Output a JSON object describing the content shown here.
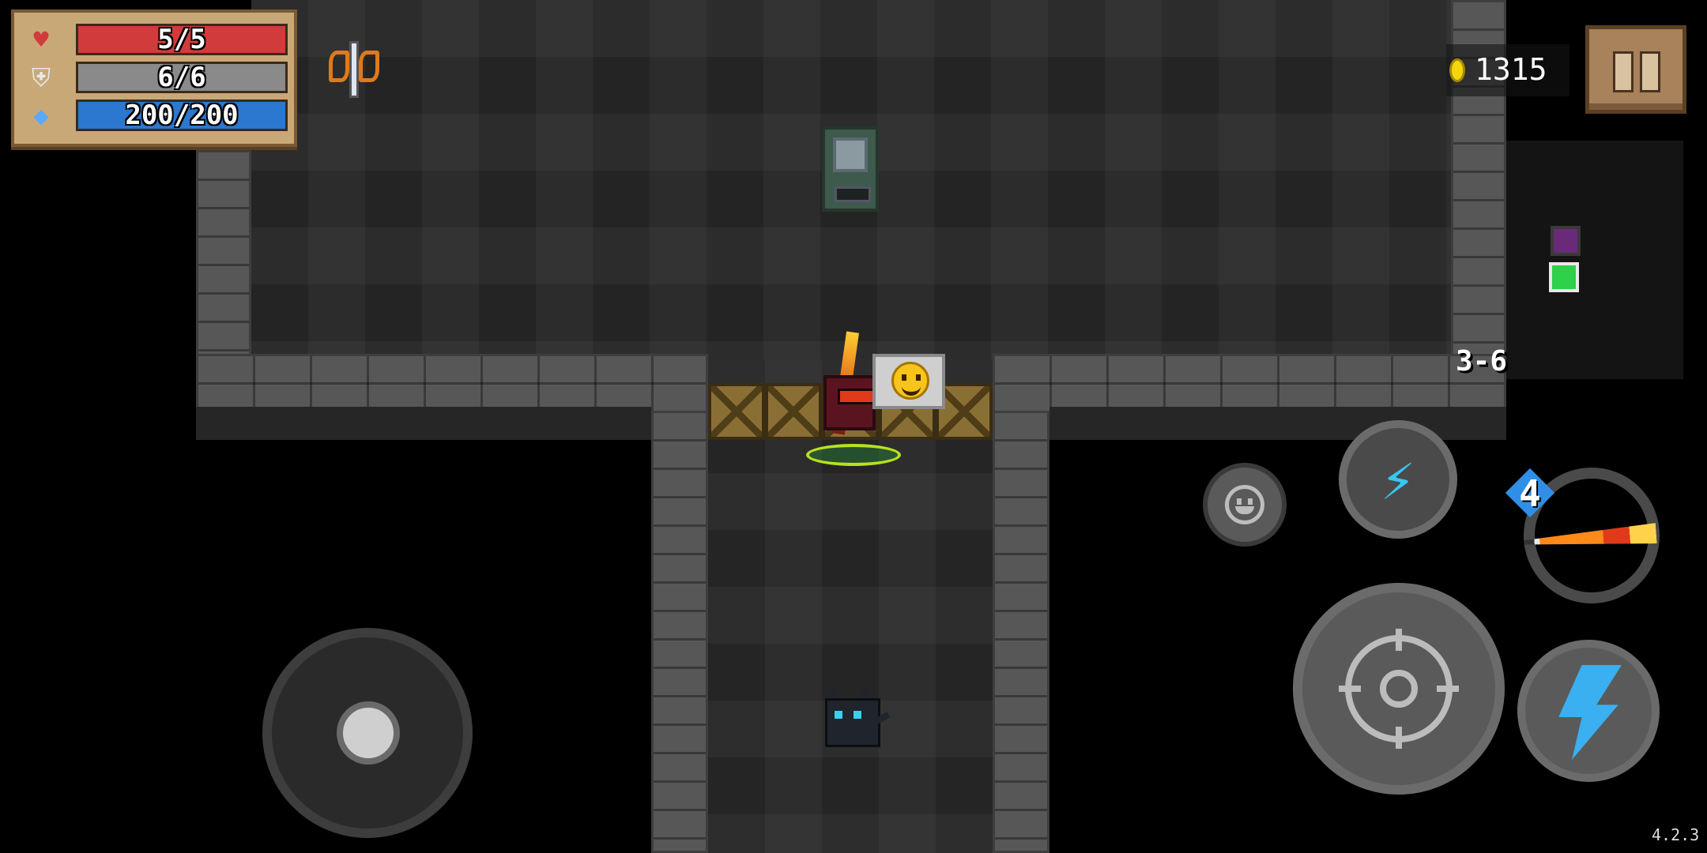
{
  "hud": {
    "health": {
      "value": "5/5",
      "fraction": 1.0,
      "color": "#d23b3b",
      "icon": "heart-icon"
    },
    "armor": {
      "value": "6/6",
      "fraction": 1.0,
      "color": "#8a8a8a",
      "icon": "shield-icon"
    },
    "energy": {
      "value": "200/200",
      "fraction": 1.0,
      "color": "#2c78d0",
      "icon": "energy-gem-icon"
    },
    "buff_icon": "winged-sword-buff-icon",
    "coins": "1315",
    "pause_icon": "pause-icon"
  },
  "minimap": {
    "level": "3-6",
    "rooms": [
      "shop-room-icon",
      "current-room-icon"
    ]
  },
  "controls": {
    "emote_icon": "smiley-face-icon",
    "skill_icon": "lightning-claw-skill-icon",
    "weapon_energy_cost": "4",
    "weapon_icon": "flame-sword-icon",
    "fire_icon": "crosshair-icon",
    "dash_icon": "lightning-bolt-icon"
  },
  "world": {
    "player_emote": "grinning-face-emote",
    "pet": "black-cat-pet"
  },
  "version": "4.2.3"
}
